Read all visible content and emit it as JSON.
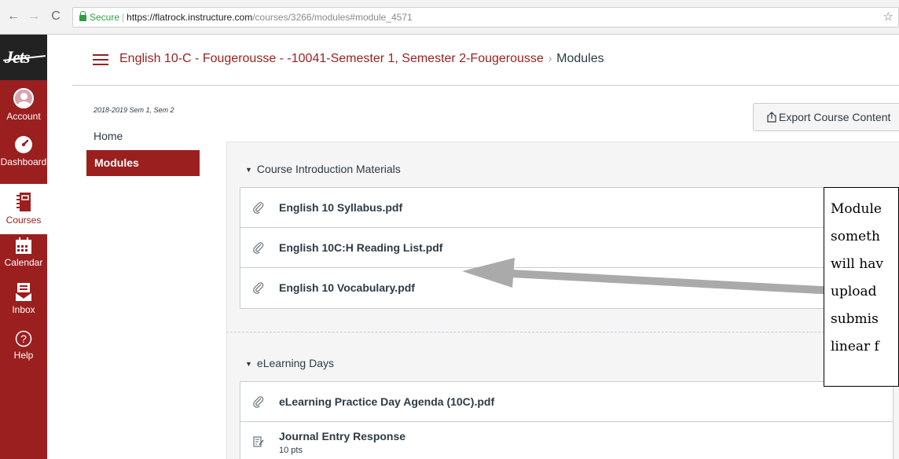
{
  "browser": {
    "back_icon": "←",
    "forward_icon": "→",
    "reload_icon": "C",
    "secure_label": "Secure",
    "url_host": "https://flatrock.instructure.com",
    "url_path": "/courses/3266/modules#module_4571",
    "bookmark_icon": "☆"
  },
  "global_nav": {
    "logo": "Jets",
    "items": [
      {
        "label": "Account",
        "icon": "account-avatar"
      },
      {
        "label": "Dashboard",
        "icon": "dashboard-icon"
      },
      {
        "label": "Courses",
        "icon": "courses-icon"
      },
      {
        "label": "Calendar",
        "icon": "calendar-icon"
      },
      {
        "label": "Inbox",
        "icon": "inbox-icon"
      },
      {
        "label": "Help",
        "icon": "help-icon"
      }
    ]
  },
  "header": {
    "course_title": "English 10-C - Fougerousse - -10041-Semester 1, Semester 2-Fougerousse",
    "separator": "›",
    "current_page": "Modules"
  },
  "course_nav": {
    "term": "2018-2019 Sem 1, Sem 2",
    "home": "Home",
    "modules": "Modules"
  },
  "toolbar": {
    "export_label": "Export Course Content"
  },
  "modules": [
    {
      "title": "Course Introduction Materials",
      "items": [
        {
          "title": "English 10 Syllabus.pdf",
          "type": "attachment"
        },
        {
          "title": "English 10C:H Reading List.pdf",
          "type": "attachment"
        },
        {
          "title": "English 10 Vocabulary.pdf",
          "type": "attachment"
        }
      ]
    },
    {
      "title": "eLearning Days",
      "items": [
        {
          "title": "eLearning Practice Day Agenda (10C).pdf",
          "type": "attachment"
        },
        {
          "title": "Journal Entry Response",
          "type": "assignment",
          "points": "10 pts"
        }
      ]
    }
  ],
  "annotation": {
    "lines": [
      "Module",
      "someth",
      "will hav",
      "upload",
      "submis",
      "linear f"
    ]
  },
  "colors": {
    "brand": "#9b1f1f",
    "text": "#2d3b45",
    "secure": "#2f9e44"
  }
}
